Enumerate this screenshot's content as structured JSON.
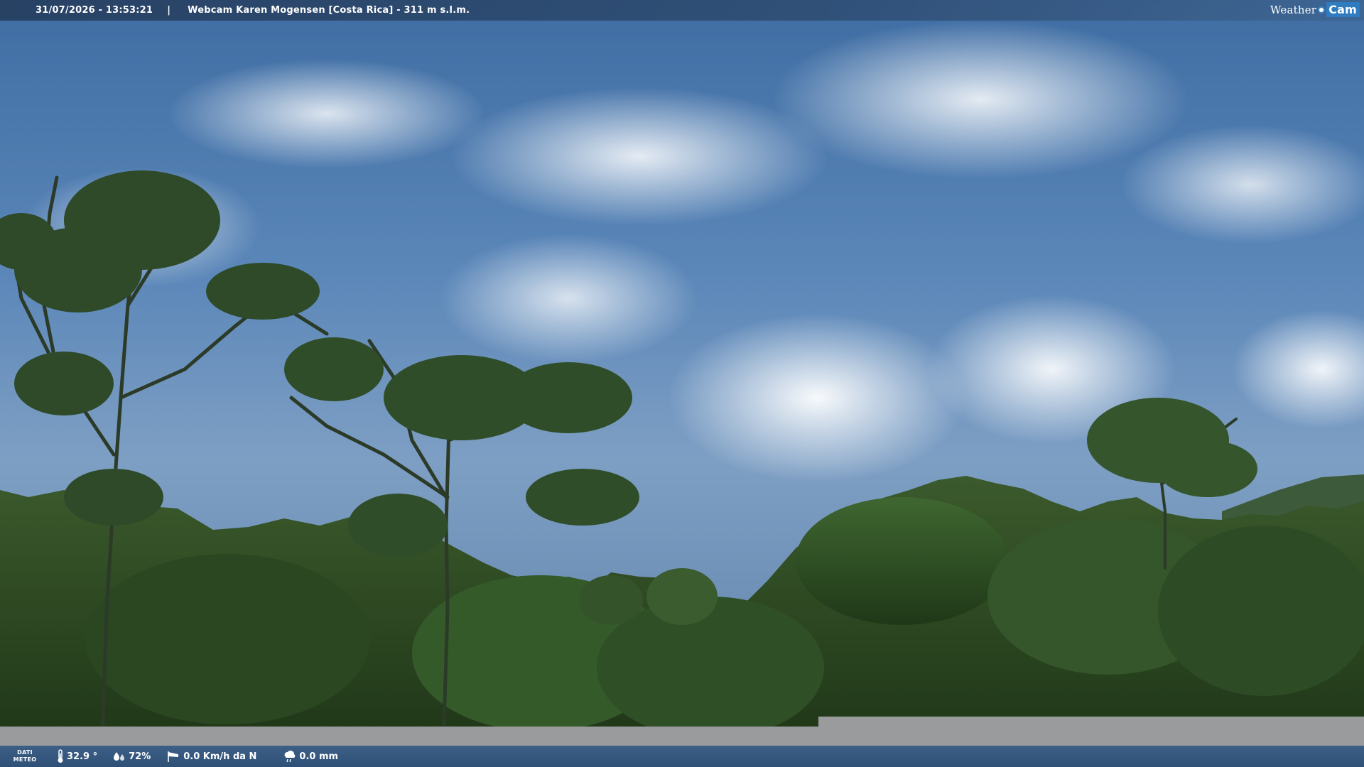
{
  "top_bar": {
    "timestamp": "31/07/2026 - 13:53:21",
    "separator": "|",
    "title": "Webcam Karen Mogensen [Costa Rica]  - 311 m s.l.m.",
    "brand_weather": "Weather",
    "brand_cam": "Cam"
  },
  "bottom_bar": {
    "label_line1": "DATI",
    "label_line2": "METEO",
    "temperature": "32.9 °",
    "temperature_icon": "thermometer-icon",
    "humidity": "72%",
    "humidity_icon": "humidity-drops-icon",
    "wind": "0.0 Km/h da N",
    "wind_icon": "wind-sock-icon",
    "rain": "0.0 mm",
    "rain_icon": "rain-cloud-icon"
  },
  "colors": {
    "bar_blue": "#2f5077",
    "brand_blue": "#2f7cc0",
    "strip_grey": "#999b9c"
  }
}
